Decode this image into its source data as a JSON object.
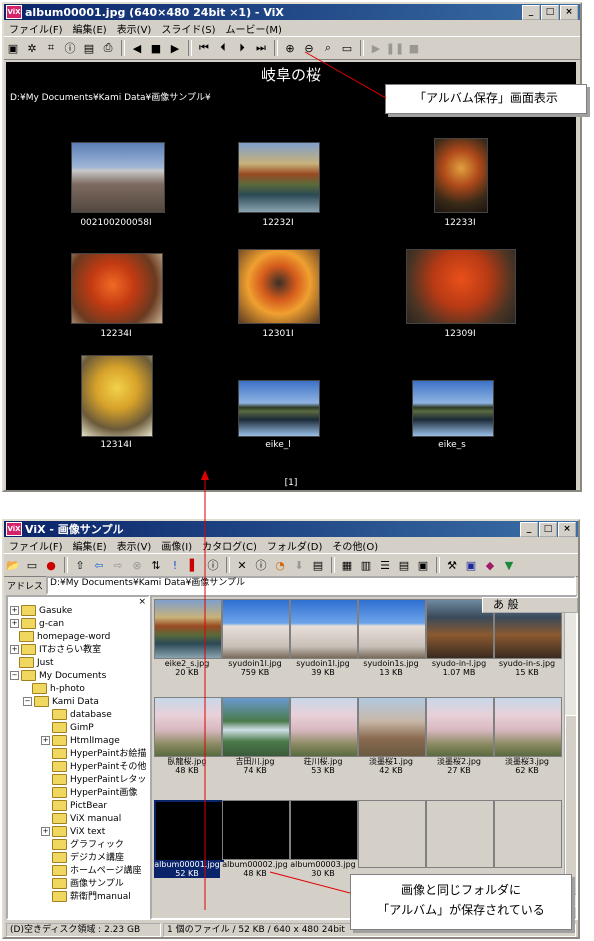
{
  "viewer": {
    "title": "album00001.jpg  (640×480 24bit  ×1) - ViX",
    "app_icon": "ViX",
    "menu": [
      "ファイル(F)",
      "編集(E)",
      "表示(V)",
      "スライド(S)",
      "ムービー(M)"
    ],
    "album_title": "岐阜の桜",
    "path": "D:¥My Documents¥Kami Data¥画像サンプル¥",
    "page": "[1]",
    "thumbs": [
      {
        "caption": "002100200058I"
      },
      {
        "caption": "12232I"
      },
      {
        "caption": "12233I"
      },
      {
        "caption": "12234I"
      },
      {
        "caption": "12301I"
      },
      {
        "caption": "12309I"
      },
      {
        "caption": "12314I"
      },
      {
        "caption": "eike_l"
      },
      {
        "caption": "eike_s"
      }
    ]
  },
  "explorer": {
    "title": "ViX - 画像サンプル",
    "app_icon": "ViX",
    "menu": [
      "ファイル(F)",
      "編集(E)",
      "表示(V)",
      "画像(I)",
      "カタログ(C)",
      "フォルダ(D)",
      "その他(O)"
    ],
    "address_label": "アドレス",
    "address": "D:¥My Documents¥Kami Data¥画像サンプル",
    "ime": "あ 般",
    "tree": [
      {
        "label": "Gasuke"
      },
      {
        "label": "g-can"
      },
      {
        "label": "homepage-word"
      },
      {
        "label": "ITおさらい教室"
      },
      {
        "label": "Just"
      },
      {
        "label": "My Documents"
      },
      {
        "label": "h-photo"
      },
      {
        "label": "Kami Data"
      },
      {
        "label": "database"
      },
      {
        "label": "GimP"
      },
      {
        "label": "HtmlImage"
      },
      {
        "label": "HyperPaintお絵描"
      },
      {
        "label": "HyperPaintその他"
      },
      {
        "label": "HyperPaintレタッ"
      },
      {
        "label": "HyperPaint画像"
      },
      {
        "label": "PictBear"
      },
      {
        "label": "ViX manual"
      },
      {
        "label": "ViX text"
      },
      {
        "label": "グラフィック"
      },
      {
        "label": "デジカメ講座"
      },
      {
        "label": "ホームページ講座"
      },
      {
        "label": "画像サンプル"
      },
      {
        "label": "薪衛門manual"
      }
    ],
    "files": [
      {
        "name": "eike2_s.jpg",
        "size": "20 KB"
      },
      {
        "name": "syudoin1l.jpg",
        "size": "759 KB"
      },
      {
        "name": "syudoin1l.jpg",
        "size": "39 KB"
      },
      {
        "name": "syudoin1s.jpg",
        "size": "13 KB"
      },
      {
        "name": "syudo-in-l.jpg",
        "size": "1.07 MB"
      },
      {
        "name": "syudo-in-s.jpg",
        "size": "15 KB"
      },
      {
        "name": "臥龍桜.jpg",
        "size": "48 KB"
      },
      {
        "name": "吉田川.jpg",
        "size": "74 KB"
      },
      {
        "name": "荘川桜.jpg",
        "size": "53 KB"
      },
      {
        "name": "淡墨桜1.jpg",
        "size": "42 KB"
      },
      {
        "name": "淡墨桜2.jpg",
        "size": "27 KB"
      },
      {
        "name": "淡墨桜3.jpg",
        "size": "62 KB"
      },
      {
        "name": "album00001.jpg",
        "size": "52 KB"
      },
      {
        "name": "album00002.jpg",
        "size": "48 KB"
      },
      {
        "name": "album00003.jpg",
        "size": "30 KB"
      }
    ],
    "status_left": "(D)空きディスク領域 : 2.23 GB",
    "status_right": "1 個のファイル / 52 KB / 640 x 480 24bit"
  },
  "callouts": {
    "save_display": "「アルバム保存」画面表示",
    "same_folder_line1": "画像と同じフォルダに",
    "same_folder_line2": "「アルバム」が保存されている"
  },
  "colors": {
    "title_active": "#0a246a",
    "selection": "#0a246a",
    "annotation_line": "#e00000"
  }
}
